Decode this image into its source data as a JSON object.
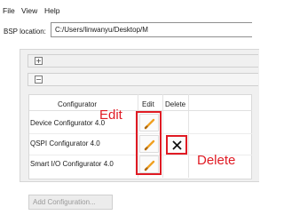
{
  "menu": [
    "File",
    "View",
    "Help"
  ],
  "bsp": {
    "label": "BSP location:",
    "value": "C:/Users/linwanyu/Desktop/M"
  },
  "sections": {
    "expand_glyph": "+",
    "collapse_glyph": "−"
  },
  "table": {
    "headers": {
      "configurator": "Configurator",
      "edit": "Edit",
      "delete": "Delete"
    },
    "rows": [
      {
        "name": "Device Configurator 4.0"
      },
      {
        "name": "QSPI Configurator 4.0"
      },
      {
        "name": "Smart I/O Configurator 4.0"
      }
    ]
  },
  "annotations": {
    "edit": "Edit",
    "delete": "Delete"
  },
  "add_button": "Add Configuration...",
  "colors": {
    "annotation_red": "#e01b24",
    "pencil_orange": "#f0a020"
  },
  "icons": {
    "edit": "pencil-icon",
    "delete": "x-icon"
  }
}
